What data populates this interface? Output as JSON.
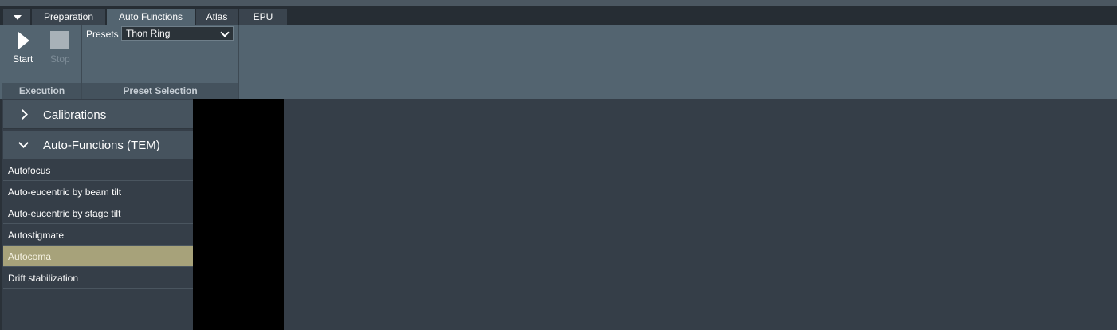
{
  "tabs": [
    {
      "label": "Preparation",
      "active": false
    },
    {
      "label": "Auto Functions",
      "active": true
    },
    {
      "label": "Atlas",
      "active": false
    },
    {
      "label": "EPU",
      "active": false
    }
  ],
  "ribbon": {
    "execution": {
      "start_label": "Start",
      "stop_label": "Stop",
      "group_label": "Execution"
    },
    "preset_selection": {
      "presets_label": "Presets",
      "selected_preset": "Thon Ring",
      "group_label": "Preset Selection"
    }
  },
  "sidebar": {
    "sections": [
      {
        "label": "Calibrations",
        "expanded": false
      },
      {
        "label": "Auto-Functions (TEM)",
        "expanded": true
      }
    ],
    "items": [
      {
        "label": "Autofocus",
        "selected": false
      },
      {
        "label": "Auto-eucentric by beam tilt",
        "selected": false
      },
      {
        "label": "Auto-eucentric by stage tilt",
        "selected": false
      },
      {
        "label": "Autostigmate",
        "selected": false
      },
      {
        "label": "Autocoma",
        "selected": true
      },
      {
        "label": "Drift stabilization",
        "selected": false
      }
    ]
  },
  "colors": {
    "selected_item": "#a7a27a",
    "ribbon": "#536470",
    "background": "#353e48"
  }
}
